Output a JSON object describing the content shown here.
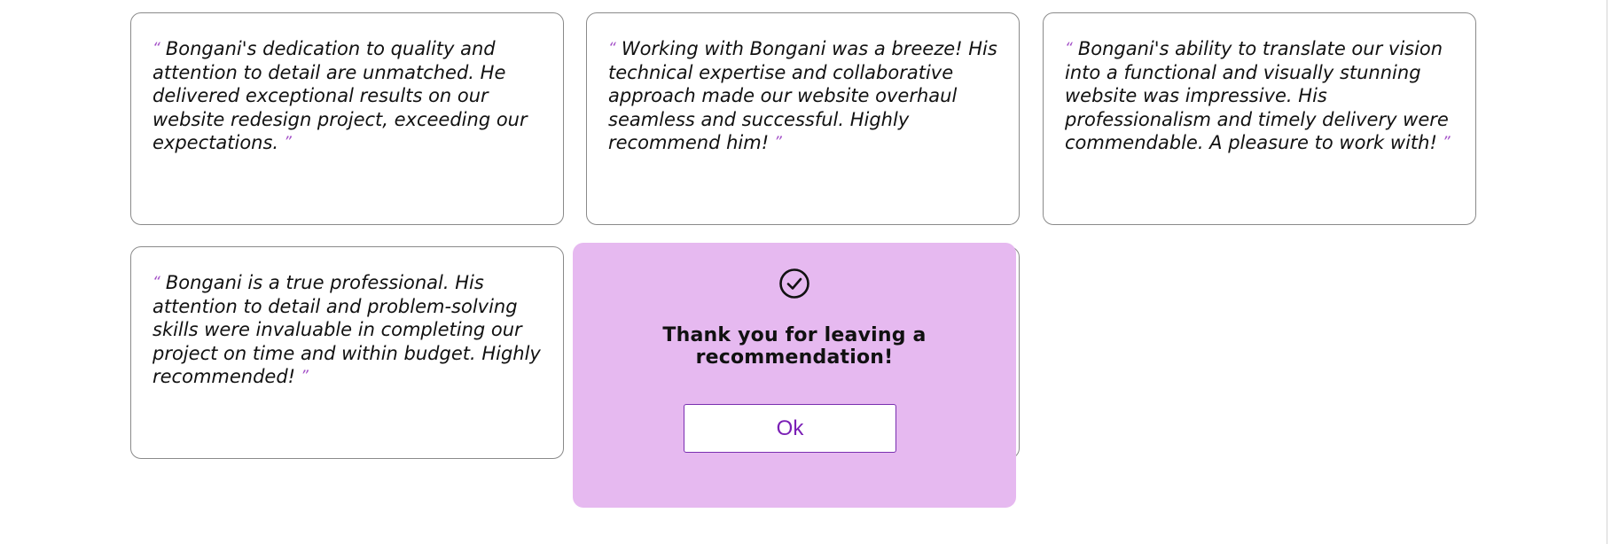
{
  "testimonials": [
    {
      "open_quote": "“",
      "text": "Bongani's dedication to quality and attention to detail are unmatched. He delivered exceptional results on our website redesign project, exceeding our expectations.",
      "close_quote": "”"
    },
    {
      "open_quote": "“",
      "text": "Working with Bongani was a breeze! His technical expertise and collaborative approach made our website overhaul seamless and successful. Highly recommend him!",
      "close_quote": "”"
    },
    {
      "open_quote": "“",
      "text": "Bongani's ability to translate our vision into a functional and visually stunning website was impressive. His professionalism and timely delivery were commendable. A pleasure to work with!",
      "close_quote": "”"
    },
    {
      "open_quote": "“",
      "text": "Bongani is a true professional. His attention to detail and problem-solving skills were invaluable in completing our project on time and within budget. Highly recommended!",
      "close_quote": "”"
    }
  ],
  "modal": {
    "icon": "check-circle-icon",
    "message": "Thank you for leaving a recommendation!",
    "ok_label": "Ok"
  },
  "colors": {
    "modal_background": "#e6b9f0",
    "accent": "#7a1fb5",
    "quote_mark": "#a24ec7",
    "card_border": "#8a8a8a"
  }
}
